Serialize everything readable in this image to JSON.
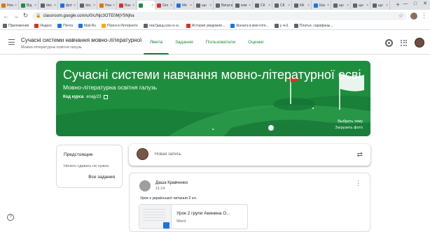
{
  "browser": {
    "tabs": [
      {
        "label": "Нон",
        "color": "#e37400"
      },
      {
        "label": "Від",
        "color": "#1e8e3e"
      },
      {
        "label": "doc",
        "color": "#5f6368"
      },
      {
        "label": "фот",
        "color": "#1a73e8"
      },
      {
        "label": "doc",
        "color": "#5f6368"
      },
      {
        "label": "Нон",
        "color": "#e37400"
      },
      {
        "label": "Вах",
        "color": "#d93025"
      },
      {
        "label": "",
        "color": "#1e8e3e"
      },
      {
        "label": "Gro",
        "color": "#d93025"
      },
      {
        "label": "Ме",
        "color": "#1a73e8"
      },
      {
        "label": "що",
        "color": "#5f6368"
      },
      {
        "label": "Випуск",
        "color": "#5f6368"
      },
      {
        "label": "ком",
        "color": "#5f6368"
      },
      {
        "label": "СК",
        "color": "#5f6368"
      },
      {
        "label": "СК",
        "color": "#5f6368"
      },
      {
        "label": "КА",
        "color": "#5f6368"
      },
      {
        "label": "Как",
        "color": "#1a73e8"
      },
      {
        "label": "що",
        "color": "#5f6368"
      },
      {
        "label": "що",
        "color": "#5f6368"
      },
      {
        "label": "що",
        "color": "#5f6368"
      }
    ],
    "new_tab": "+",
    "window_controls": [
      "—",
      "□",
      "✕"
    ],
    "url": "classroom.google.com/u/0/c/Njc3OTE0MjY5Njha",
    "bookmarks": [
      {
        "label": "Приложения",
        "color": "#5f6368"
      },
      {
        "label": "Яндекс",
        "color": "#d93025"
      },
      {
        "label": "Почта",
        "color": "#1a73e8"
      },
      {
        "label": "Mail.Ru",
        "color": "#1a73e8"
      },
      {
        "label": "Поиск в Интернете",
        "color": "#f9ab00"
      },
      {
        "label": "гнж7дацц кхю ю ю..",
        "color": "#5f6368"
      },
      {
        "label": "История уведомле...",
        "color": "#d93025"
      },
      {
        "label": "Кінната в міні-готе...",
        "color": "#1a73e8"
      },
      {
        "label": "у чн1",
        "color": "#5f6368"
      },
      {
        "label": "Платья, сарафаны...",
        "color": "#5f6368"
      }
    ]
  },
  "app": {
    "course_title": "Сучасні системи навчання мовно-літературної ...",
    "course_subtitle": "Мовно-літературна освітня галузь",
    "tabs": [
      "Лента",
      "Задания",
      "Пользователи",
      "Оценки"
    ],
    "accent": "#137333"
  },
  "banner": {
    "title": "Сучасні системи навчання мовно-літературної освіт...",
    "subtitle": "Мовно-літературна освітня галузь",
    "code_label": "Код курса",
    "code_value": "enajy23",
    "select_theme": "Выбрать тему",
    "upload_photo": "Загрузить фото",
    "color": "#1e8e3e"
  },
  "upcoming": {
    "heading": "Предстоящие",
    "empty_text": "Ничего сдавать не нужно",
    "all_link": "Все задания"
  },
  "new_post": {
    "placeholder": "Новая запись"
  },
  "post": {
    "author": "Даша Кравченко",
    "time": "11:14",
    "text": "Урок з української читання 2 кл.",
    "attachment_name": "Урок 2 групи Акинина О...",
    "attachment_type": "Word"
  },
  "help": "?"
}
